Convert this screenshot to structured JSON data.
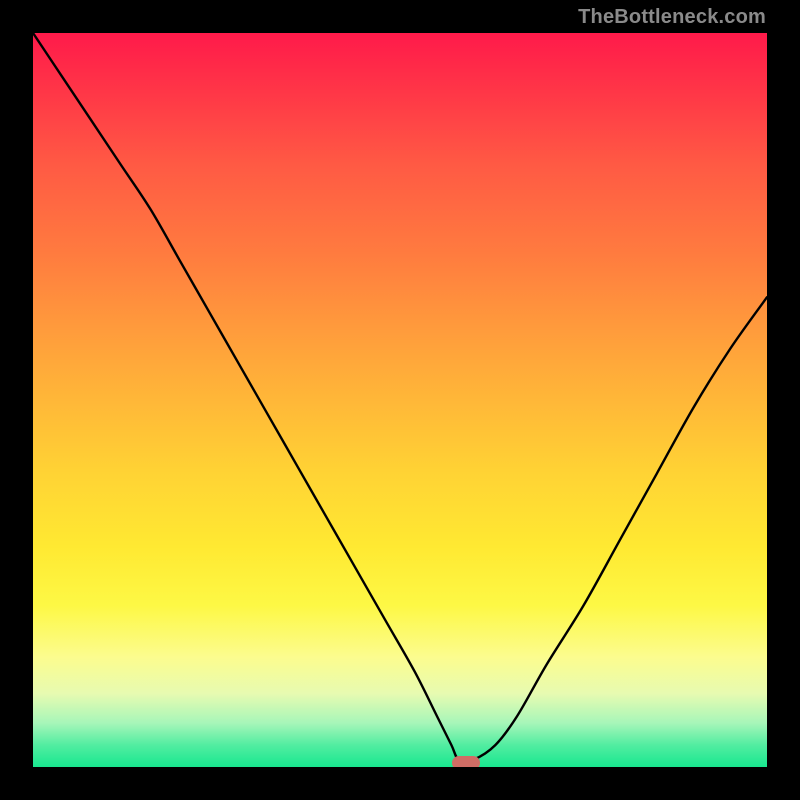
{
  "watermark": "TheBottleneck.com",
  "marker_color": "#cf6d65",
  "chart_data": {
    "type": "line",
    "title": "",
    "xlabel": "",
    "ylabel": "",
    "xlim": [
      0,
      100
    ],
    "ylim": [
      0,
      100
    ],
    "grid": false,
    "x": [
      0,
      4,
      8,
      12,
      16,
      20,
      24,
      28,
      32,
      36,
      40,
      44,
      48,
      52,
      55,
      57,
      58,
      60,
      63,
      66,
      70,
      75,
      80,
      85,
      90,
      95,
      100
    ],
    "values": [
      100,
      94,
      88,
      82,
      76,
      69,
      62,
      55,
      48,
      41,
      34,
      27,
      20,
      13,
      7,
      3,
      1,
      1,
      3,
      7,
      14,
      22,
      31,
      40,
      49,
      57,
      64
    ],
    "minimum": {
      "x": 59,
      "y": 0.5
    }
  }
}
